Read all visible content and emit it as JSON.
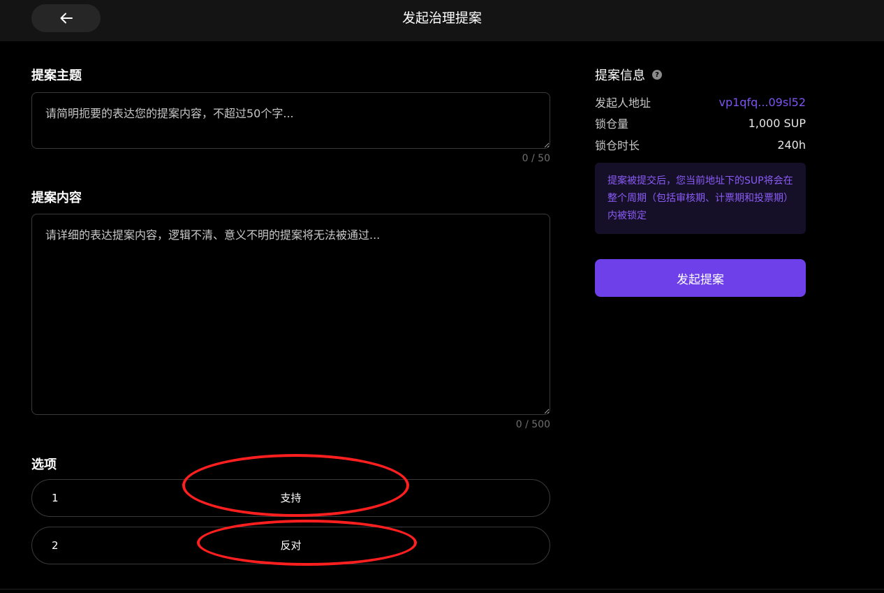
{
  "header": {
    "title": "发起治理提案",
    "back_icon": "arrow-left-icon"
  },
  "form": {
    "subject": {
      "label": "提案主题",
      "placeholder": "请简明扼要的表达您的提案内容，不超过50个字...",
      "value": "",
      "counter": "0 / 50"
    },
    "content": {
      "label": "提案内容",
      "placeholder": "请详细的表达提案内容，逻辑不清、意义不明的提案将无法被通过...",
      "value": "",
      "counter": "0 / 500"
    },
    "options": {
      "label": "选项",
      "items": [
        {
          "number": "1",
          "text": "支持"
        },
        {
          "number": "2",
          "text": "反对"
        }
      ]
    }
  },
  "info": {
    "title": "提案信息",
    "help_icon": "question-circle-icon",
    "rows": [
      {
        "key": "发起人地址",
        "value": "vp1qfq...09sl52"
      },
      {
        "key": "锁仓量",
        "value": "1,000 SUP"
      },
      {
        "key": "锁仓时长",
        "value": "240h"
      }
    ],
    "notice": "提案被提交后，您当前地址下的SUP将会在整个周期（包括审核期、计票期和投票期）内被锁定",
    "submit_label": "发起提案"
  },
  "colors": {
    "accent": "#6e40ea",
    "link": "#7c55f0",
    "notice_text": "#8a5cf5",
    "annotation": "#ff1f1f"
  }
}
